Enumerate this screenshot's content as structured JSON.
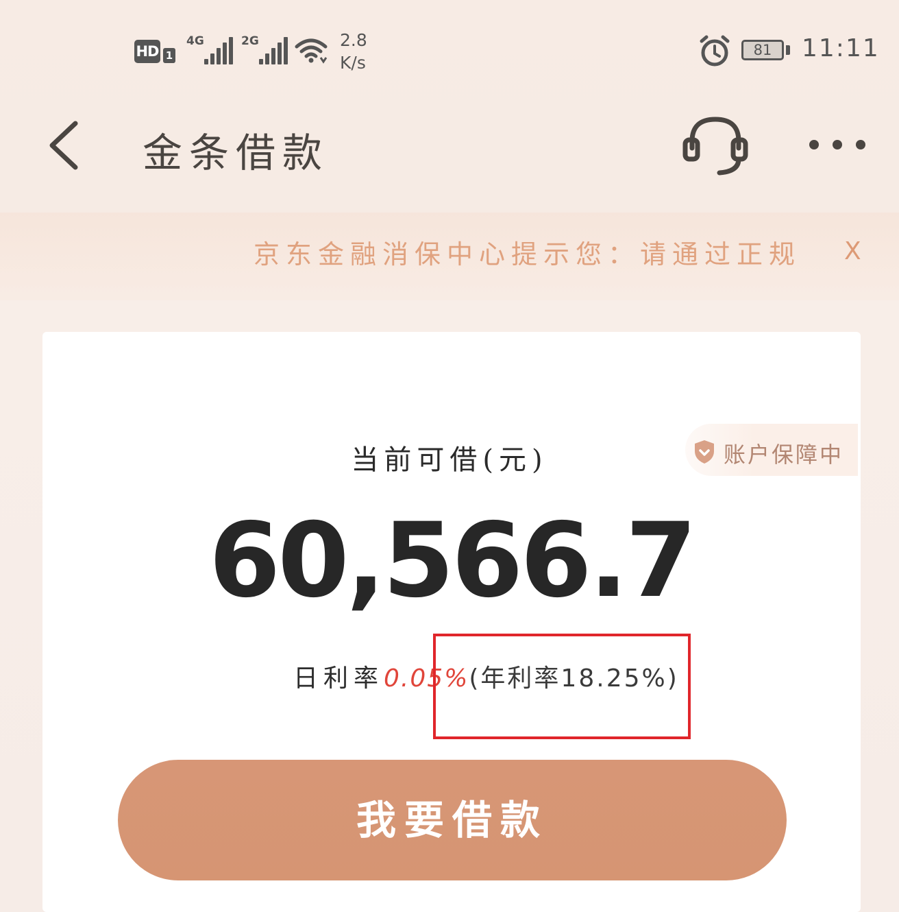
{
  "status_bar": {
    "hd": "HD",
    "hd_sub": "1",
    "net_1": "4G",
    "net_2": "2G",
    "speed": "2.8\nK/s",
    "battery": "81",
    "time": "11:11"
  },
  "nav": {
    "title": "金条借款",
    "icons": [
      "back-icon",
      "headset-icon",
      "more-icon"
    ]
  },
  "notice": {
    "text": "京东金融消保中心提示您：请通过正规",
    "close": "X"
  },
  "card": {
    "badge": "账户保障中",
    "amount_label": "当前可借(元)",
    "amount": "60,566.7",
    "daily_rate_label": "日利率",
    "daily_rate_value": "0.05%",
    "annual_rate": "(年利率18.25%)",
    "borrow_button": "我要借款"
  },
  "colors": {
    "accent": "#d79676",
    "rate_highlight": "#e0453a",
    "annotation_box": "#e0262b",
    "notice_text": "#e0a27f"
  }
}
